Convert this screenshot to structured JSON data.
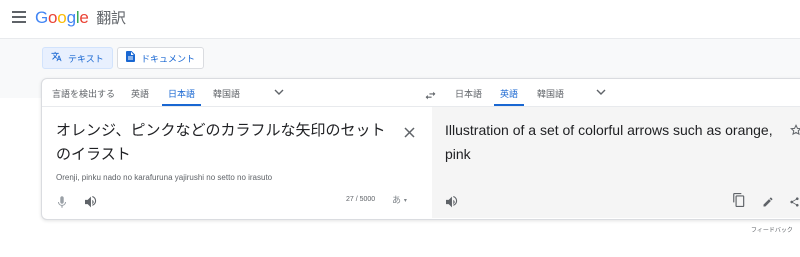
{
  "header": {
    "logo_letters": [
      "G",
      "o",
      "o",
      "g",
      "l",
      "e"
    ],
    "product": "翻訳"
  },
  "modes": [
    {
      "label": "テキスト",
      "icon": "translate-icon"
    },
    {
      "label": "ドキュメント",
      "icon": "document-icon"
    }
  ],
  "source_langs": {
    "detect": "言語を検出する",
    "english": "英語",
    "japanese": "日本語",
    "korean": "韓国語"
  },
  "target_langs": {
    "japanese": "日本語",
    "english": "英語",
    "korean": "韓国語"
  },
  "source": {
    "text": "オレンジ、ピンクなどのカラフルな矢印のセットのイラスト",
    "transliteration": "Orenji, pinku nado no karafuruna yajirushi no setto no irasuto",
    "char_count": "27 / 5000",
    "ime": "あ"
  },
  "target": {
    "text": "Illustration of a set of colorful arrows such as orange, pink"
  },
  "footer": {
    "feedback": "フィードバック"
  },
  "colors": {
    "accent": "#1967d2",
    "icon": "#5f6368"
  }
}
